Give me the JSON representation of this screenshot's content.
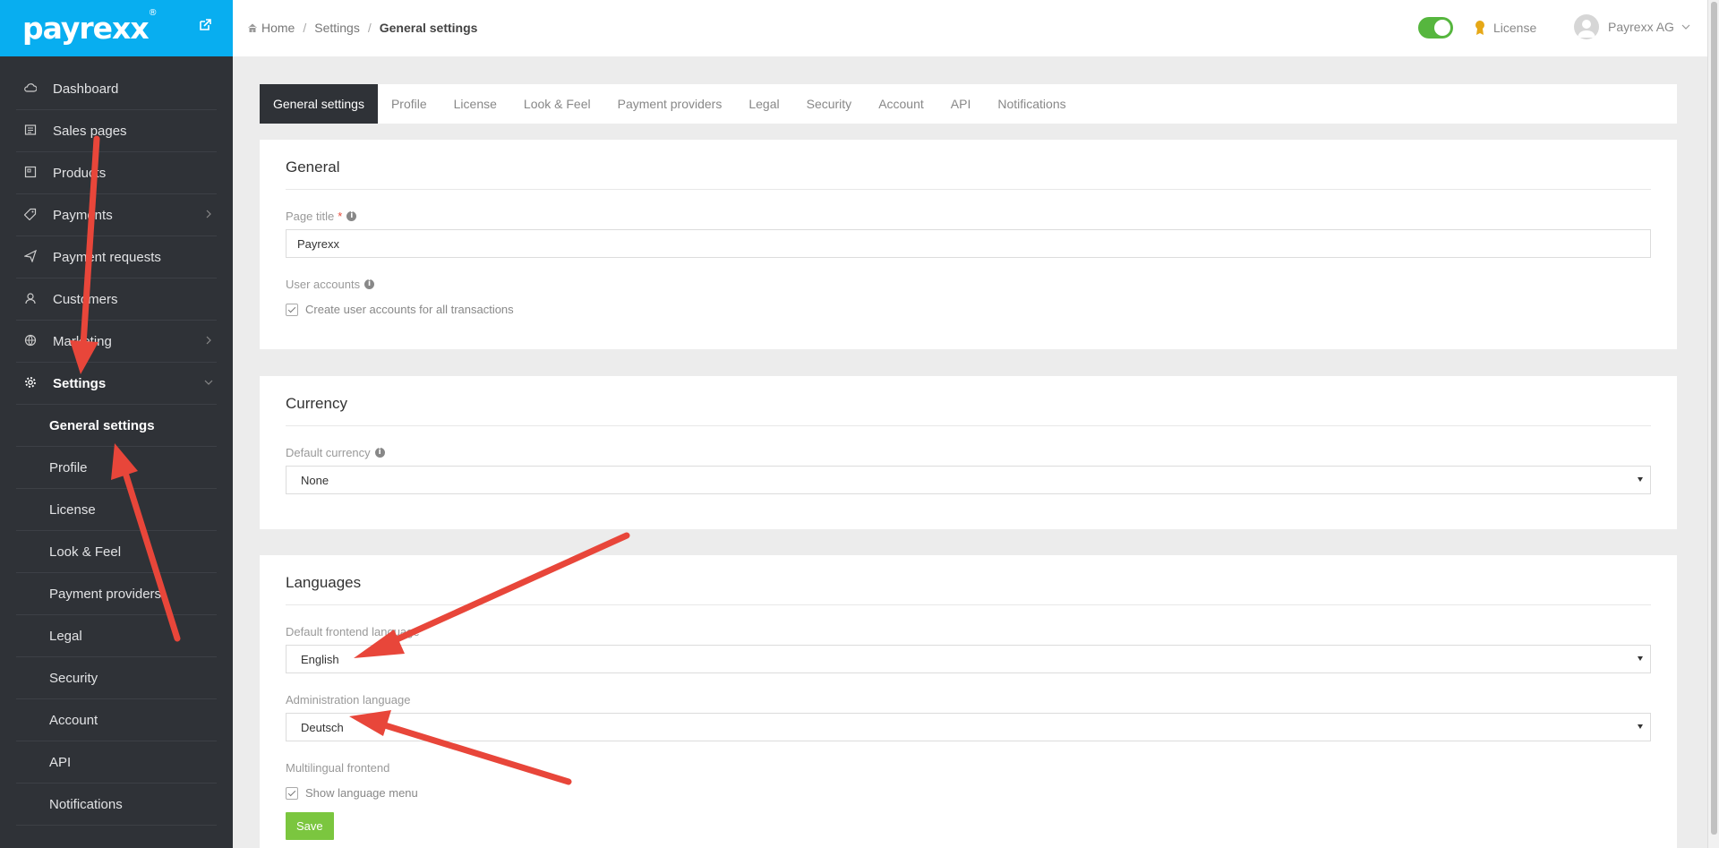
{
  "brand": {
    "logo": "payrexx",
    "registered": "®"
  },
  "sidebar": {
    "items": [
      {
        "label": "Dashboard",
        "icon": "cloud-icon"
      },
      {
        "label": "Sales pages",
        "icon": "page-icon"
      },
      {
        "label": "Products",
        "icon": "box-icon"
      },
      {
        "label": "Payments",
        "icon": "tag-icon"
      },
      {
        "label": "Payment requests",
        "icon": "paper-plane-icon"
      },
      {
        "label": "Customers",
        "icon": "user-icon"
      },
      {
        "label": "Marketing",
        "icon": "globe-icon"
      },
      {
        "label": "Settings",
        "icon": "gear-icon"
      }
    ],
    "sub_items": [
      "General settings",
      "Profile",
      "License",
      "Look & Feel",
      "Payment providers",
      "Legal",
      "Security",
      "Account",
      "API",
      "Notifications"
    ]
  },
  "breadcrumb": {
    "home": "Home",
    "sep": "/",
    "settings": "Settings",
    "current": "General settings"
  },
  "topbar": {
    "license": "License",
    "user": "Payrexx AG"
  },
  "tabs": [
    "General settings",
    "Profile",
    "License",
    "Look & Feel",
    "Payment providers",
    "Legal",
    "Security",
    "Account",
    "API",
    "Notifications"
  ],
  "general": {
    "title": "General",
    "page_title_label": "Page title",
    "required_mark": "*",
    "page_title_value": "Payrexx",
    "user_accounts_label": "User accounts",
    "user_accounts_check": "Create user accounts for all transactions"
  },
  "currency": {
    "title": "Currency",
    "default_label": "Default currency",
    "default_value": "None"
  },
  "languages": {
    "title": "Languages",
    "frontend_label": "Default frontend language",
    "frontend_value": "English",
    "admin_label": "Administration language",
    "admin_value": "Deutsch",
    "multilingual_label": "Multilingual frontend",
    "multilingual_check": "Show language menu",
    "save": "Save"
  },
  "colors": {
    "brand": "#08aef0",
    "sidebar": "#2f3237",
    "save": "#7bc63f",
    "toggle": "#56b63e",
    "arrow": "#e8463a"
  }
}
